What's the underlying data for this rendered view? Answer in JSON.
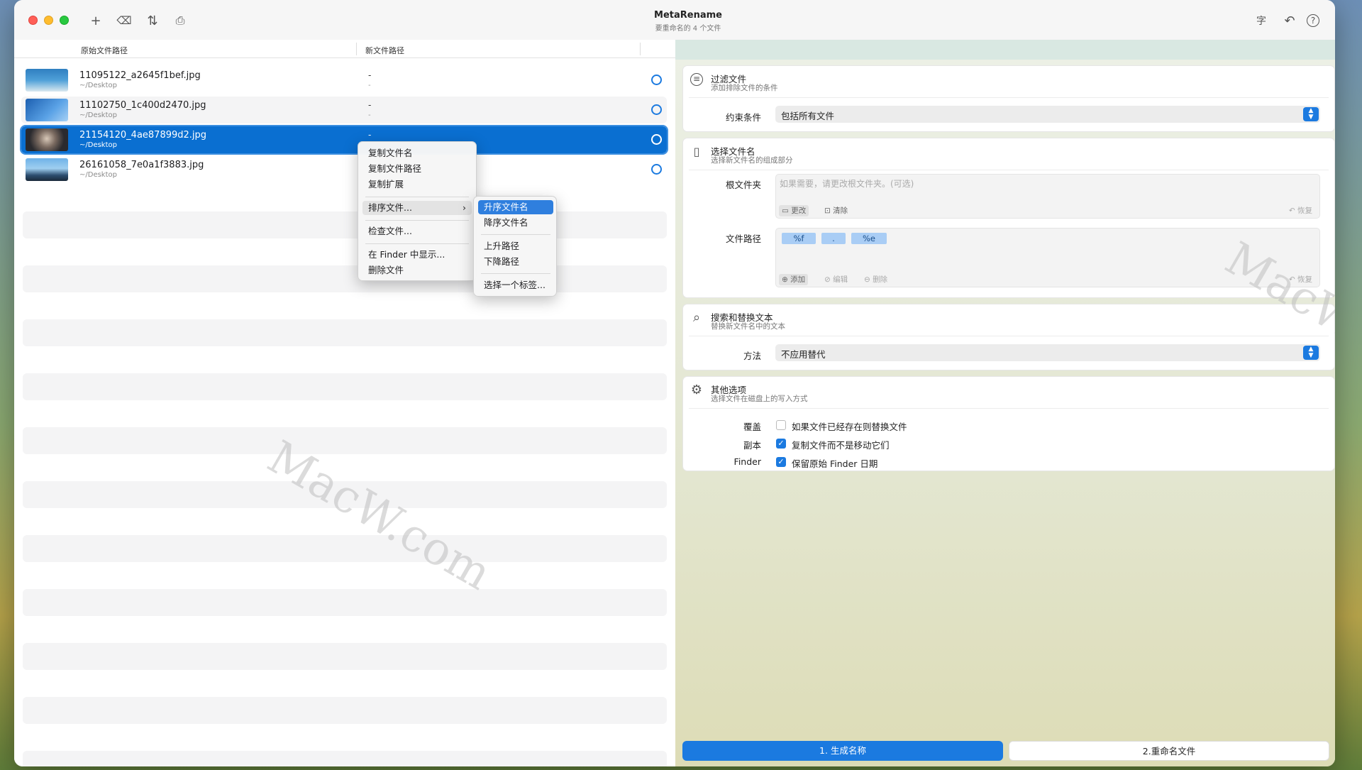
{
  "window": {
    "title": "MetaRename",
    "subtitle": "要重命名的 4 个文件"
  },
  "toolbar": {
    "add_icon": "+",
    "remove_icon": "⌫",
    "sort_icon": "⇅",
    "inspect_icon": "⎙",
    "text_icon": "字",
    "undo_icon": "↶",
    "help_icon": "?"
  },
  "table": {
    "col_original": "原始文件路径",
    "col_new": "新文件路径",
    "rows": [
      {
        "name": "11095122_a2645f1bef.jpg",
        "path": "~/Desktop",
        "new_name": "-",
        "new_path": "-"
      },
      {
        "name": "11102750_1c400d2470.jpg",
        "path": "~/Desktop",
        "new_name": "-",
        "new_path": "-"
      },
      {
        "name": "21154120_4ae87899d2.jpg",
        "path": "~/Desktop",
        "new_name": "-",
        "new_path": ""
      },
      {
        "name": "26161058_7e0a1f3883.jpg",
        "path": "~/Desktop",
        "new_name": "",
        "new_path": ""
      }
    ]
  },
  "context_menu": {
    "items": [
      "复制文件名",
      "复制文件路径",
      "复制扩展",
      "排序文件...",
      "检查文件...",
      "在 Finder 中显示...",
      "删除文件"
    ],
    "submenu_arrow": "›"
  },
  "sub_menu": {
    "items": [
      "升序文件名",
      "降序文件名",
      "上升路径",
      "下降路径",
      "选择一个标签..."
    ]
  },
  "filter": {
    "title": "过滤文件",
    "subtitle": "添加排除文件的条件",
    "label": "约束条件",
    "value": "包括所有文件",
    "icon": "≡"
  },
  "filename": {
    "title": "选择文件名",
    "subtitle": "选择新文件名的组成部分",
    "icon": "▯",
    "root_label": "根文件夹",
    "root_placeholder": "如果需要，请更改根文件夹。(可选)",
    "btn_change": "更改",
    "btn_clear": "清除",
    "btn_restore": "恢复",
    "path_label": "文件路径",
    "tokens": [
      "%f",
      ".",
      "%e"
    ],
    "btn_add": "添加",
    "btn_edit": "编辑",
    "btn_delete": "删除",
    "btn_restore2": "恢复"
  },
  "search": {
    "title": "搜索和替换文本",
    "subtitle": "替换新文件名中的文本",
    "icon": "⌕",
    "label": "方法",
    "value": "不应用替代"
  },
  "other": {
    "title": "其他选项",
    "subtitle": "选择文件在磁盘上的写入方式",
    "icon": "⚙",
    "opt1_label": "覆盖",
    "opt1_text": "如果文件已经存在则替换文件",
    "opt2_label": "副本",
    "opt2_text": "复制文件而不是移动它们",
    "opt3_label": "Finder",
    "opt3_text": "保留原始 Finder 日期",
    "check_mark": "✓"
  },
  "actions": {
    "generate": "1. 生成名称",
    "rename": "2.重命名文件"
  },
  "watermark": "MacW.com",
  "colors": {
    "accent": "#1b7ae0",
    "selection": "#0a6fd1"
  }
}
